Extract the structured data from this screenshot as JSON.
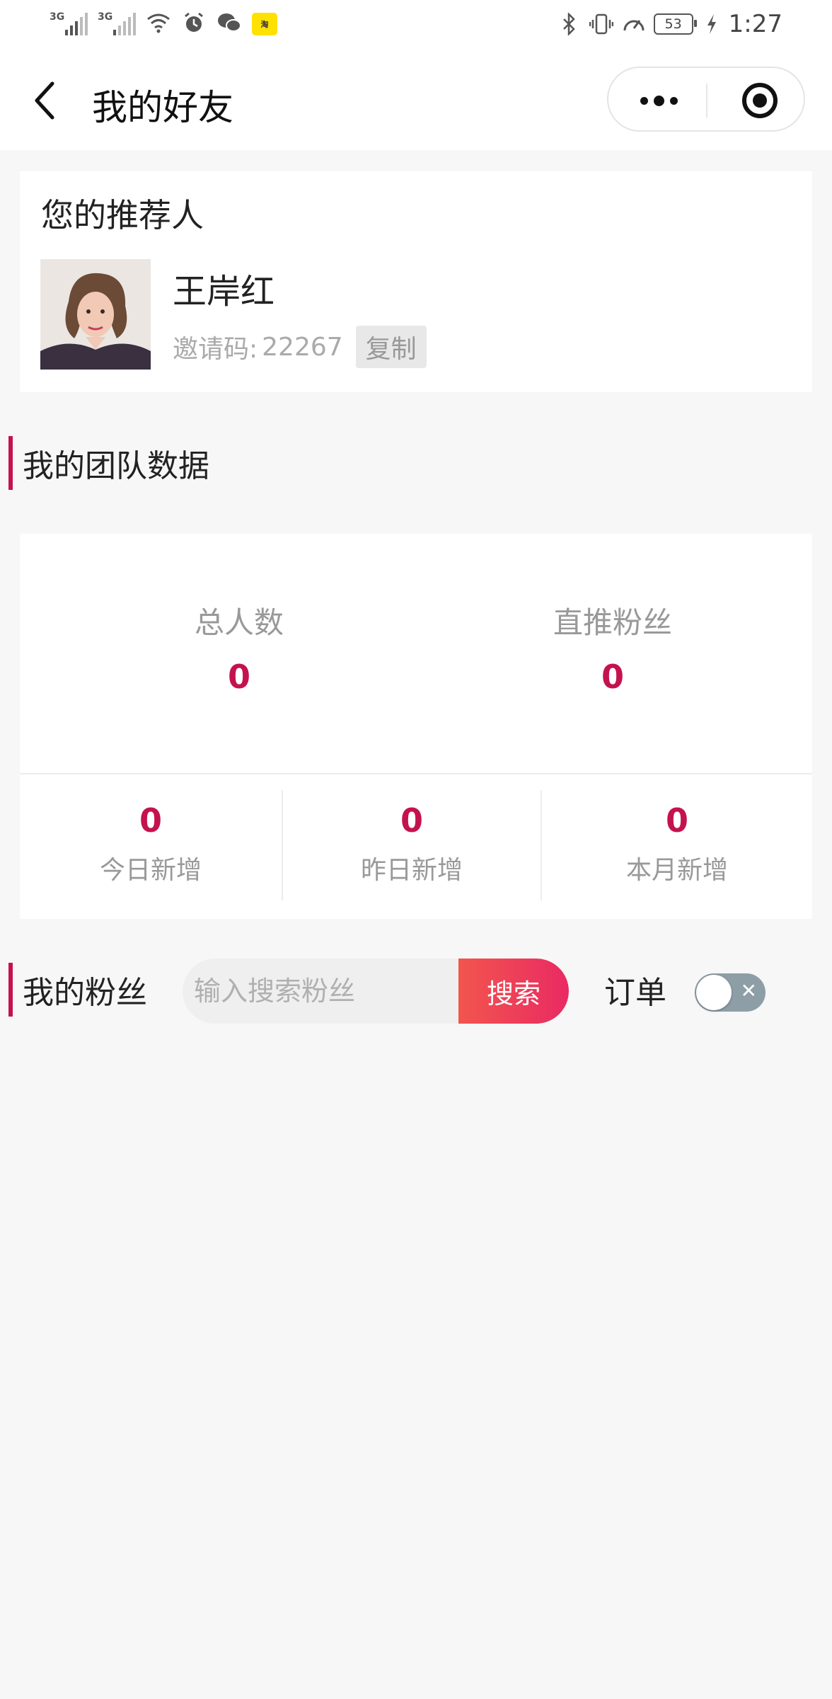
{
  "status_bar": {
    "signal1_label": "3G",
    "signal2_label": "3G",
    "battery": "53",
    "time": "1:27"
  },
  "nav": {
    "title": "我的好友",
    "icons": [
      "back-arrow-icon",
      "more-dots-icon",
      "target-circle-icon"
    ]
  },
  "referrer": {
    "section_title": "您的推荐人",
    "name": "王岸红",
    "code_label": "邀请码:",
    "code_value": "22267",
    "copy_label": "复制"
  },
  "team": {
    "section_title": "我的团队数据",
    "total_label": "总人数",
    "total_value": "0",
    "direct_label": "直推粉丝",
    "direct_value": "0",
    "today_label": "今日新增",
    "today_value": "0",
    "yesterday_label": "昨日新增",
    "yesterday_value": "0",
    "month_label": "本月新增",
    "month_value": "0"
  },
  "fans": {
    "section_title": "我的粉丝",
    "search_placeholder": "输入搜索粉丝",
    "search_button": "搜索",
    "order_label": "订单",
    "order_toggle_on": false
  },
  "colors": {
    "accent": "#c4124f",
    "search_gradient_start": "#f2554e",
    "search_gradient_end": "#e92a63",
    "toggle_off": "#8e9ea6"
  }
}
